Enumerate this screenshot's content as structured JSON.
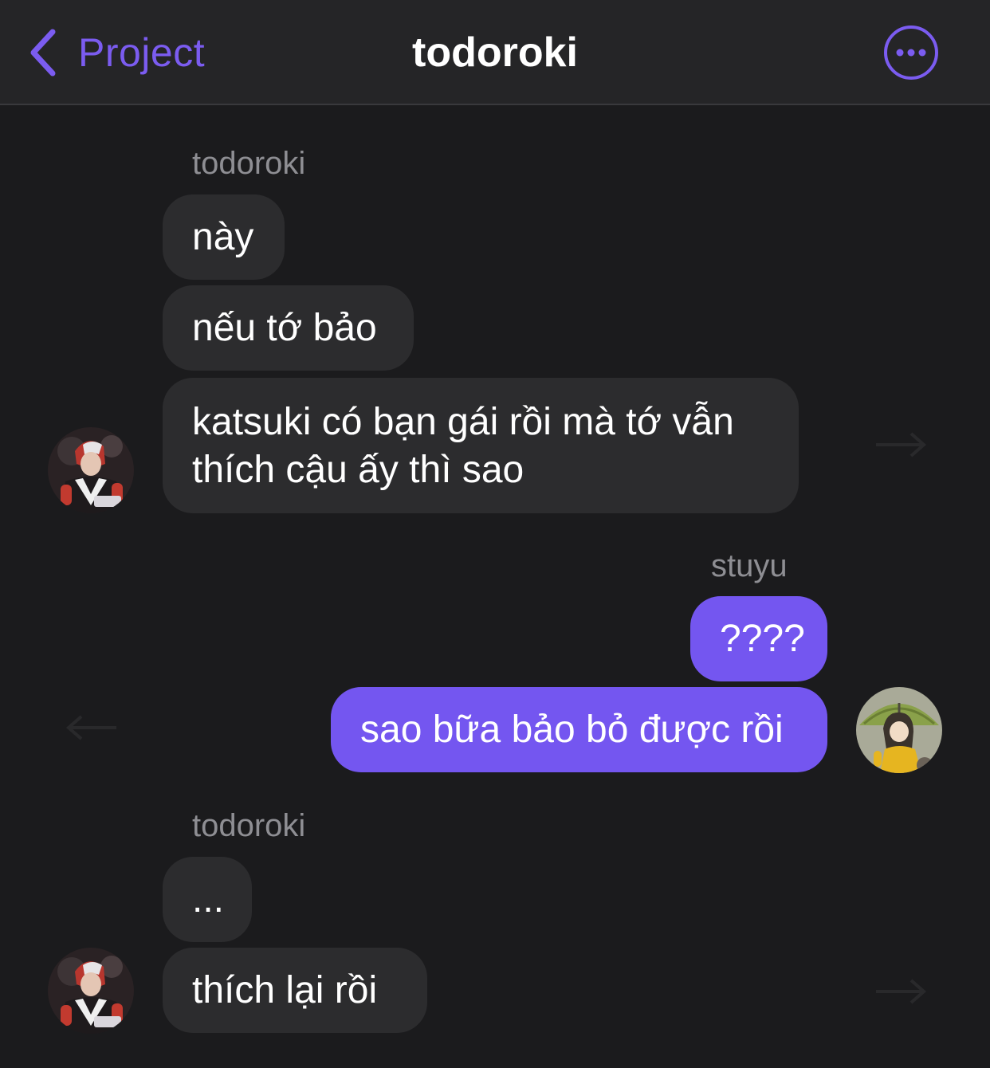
{
  "header": {
    "back_label": "Project",
    "title": "todoroki",
    "accent_color": "#7b5cf0"
  },
  "messages": {
    "group1": {
      "sender": "todoroki",
      "bubbles": [
        "này",
        "nếu tớ bảo",
        "katsuki có bạn gái rồi mà tớ vẫn",
        "thích cậu ấy thì sao"
      ]
    },
    "group2": {
      "sender": "stuyu",
      "bubbles": [
        "????",
        "sao bữa bảo bỏ được rồi"
      ]
    },
    "group3": {
      "sender": "todoroki",
      "bubbles": [
        "...",
        "thích lại rồi"
      ]
    }
  },
  "colors": {
    "background": "#1b1b1d",
    "incoming_bubble": "#2c2c2e",
    "outgoing_bubble": "#7456f0",
    "sender_label": "#8e8e93"
  },
  "icons": {
    "back": "chevron-left-icon",
    "more": "ellipsis-circle-icon",
    "reply": "arrow-icon"
  }
}
